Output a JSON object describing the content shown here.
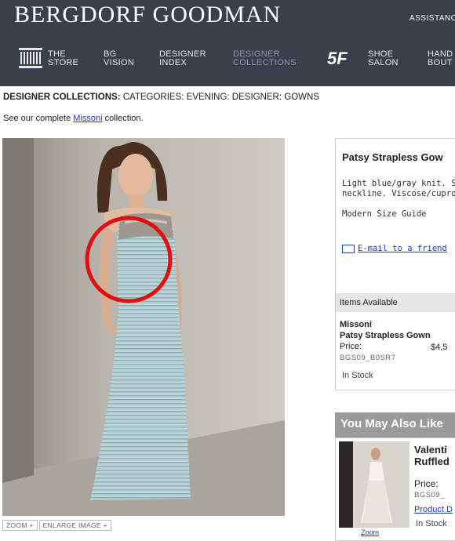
{
  "header": {
    "logo": "BERGDORF GOODMAN",
    "assistance": "ASSISTANC",
    "nav": [
      {
        "line1": "THE",
        "line2": "STORE"
      },
      {
        "line1": "BG",
        "line2": "VISION"
      },
      {
        "line1": "DESIGNER",
        "line2": "INDEX"
      },
      {
        "line1": "DESIGNER",
        "line2": "COLLECTIONS"
      },
      {
        "line1": "5F",
        "line2": ""
      },
      {
        "line1": "SHOE",
        "line2": "SALON"
      },
      {
        "line1": "HAND",
        "line2": "BOUT"
      }
    ]
  },
  "breadcrumb": {
    "lead": "DESIGNER COLLECTIONS:",
    "rest": " CATEGORIES: EVENING: DESIGNER: GOWNS"
  },
  "see_all": {
    "before": "See our complete ",
    "link": "Missoni",
    "after": " collection."
  },
  "image_controls": {
    "zoom": "ZOOM +",
    "enlarge": "ENLARGE IMAGE +"
  },
  "product": {
    "title": "Patsy Strapless Gow",
    "desc_line1": "Light blue/gray knit. S",
    "desc_line2": "neckline. Viscose/cupro",
    "size_guide": "Modern Size Guide",
    "email": "E-mail to a friend"
  },
  "items": {
    "header": "Items Available",
    "brand": "Missoni",
    "name": "Patsy Strapless Gown",
    "price_label": "Price:",
    "price_value": "$4,5",
    "sku": "BGS09_B0SR7",
    "stock": "In Stock"
  },
  "ymal": {
    "header": "You May Also Like",
    "name_line1": "Valenti",
    "name_line2": "Ruffled",
    "price_label": "Price:",
    "sku": "BGS09_",
    "link": "Product D",
    "stock": "In Stock",
    "zoom": "Zoom"
  },
  "colors": {
    "header_bg": "#3a3f4a",
    "link": "#1b3fb8",
    "active_nav": "#9a8fb4",
    "annotation_circle": "#e01010"
  }
}
